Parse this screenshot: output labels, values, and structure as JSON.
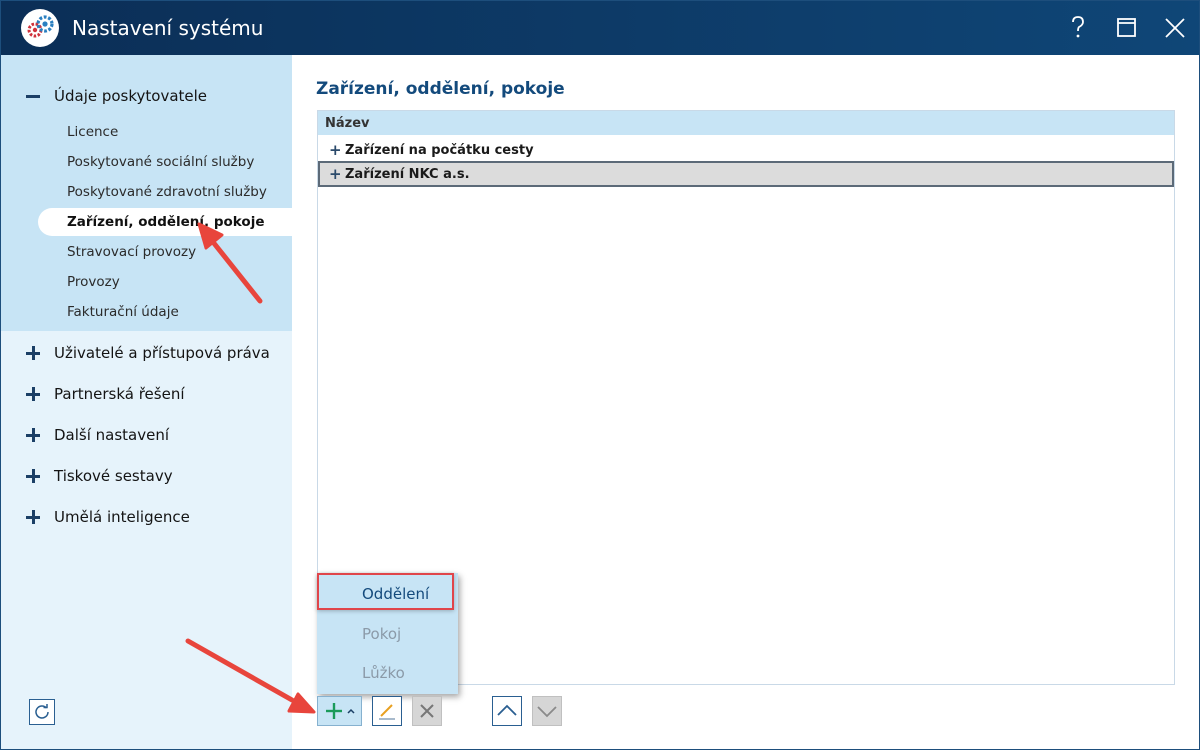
{
  "window": {
    "title": "Nastavení systému",
    "icons": {
      "logo": "gears-icon",
      "help": "question-icon",
      "maximize": "maximize-icon",
      "close": "close-icon"
    }
  },
  "sidebar": {
    "groups": [
      {
        "label": "Údaje poskytovatele",
        "expanded": true,
        "items": [
          {
            "label": "Licence"
          },
          {
            "label": "Poskytované sociální služby"
          },
          {
            "label": "Poskytované zdravotní služby"
          },
          {
            "label": "Zařízení, oddělení, pokoje",
            "active": true
          },
          {
            "label": "Stravovací provozy"
          },
          {
            "label": "Provozy"
          },
          {
            "label": "Fakturační údaje"
          }
        ]
      },
      {
        "label": "Uživatelé a přístupová práva",
        "expanded": false
      },
      {
        "label": "Partnerská řešení",
        "expanded": false
      },
      {
        "label": "Další nastavení",
        "expanded": false
      },
      {
        "label": "Tiskové sestavy",
        "expanded": false
      },
      {
        "label": "Umělá inteligence",
        "expanded": false
      }
    ]
  },
  "main": {
    "title": "Zařízení, oddělení, pokoje",
    "table": {
      "header": "Název",
      "rows": [
        {
          "label": "Zařízení na počátku cesty",
          "selected": false
        },
        {
          "label": "Zařízení NKC a.s.",
          "selected": true
        }
      ]
    }
  },
  "dropdown": {
    "items": [
      {
        "label": "Oddělení",
        "enabled": true,
        "highlighted": true
      },
      {
        "label": "Pokoj",
        "enabled": false
      },
      {
        "label": "Lůžko",
        "enabled": false
      }
    ]
  },
  "toolbar": {
    "buttons": [
      "add-dropdown",
      "edit",
      "delete",
      "move-up",
      "move-down"
    ]
  },
  "colors": {
    "titlebar": "#0b2e56",
    "accent": "#134a7c",
    "sidebar_open_group": "#c7e4f5",
    "highlight_border": "#e0454a",
    "annotation_arrow": "#e8453c"
  }
}
